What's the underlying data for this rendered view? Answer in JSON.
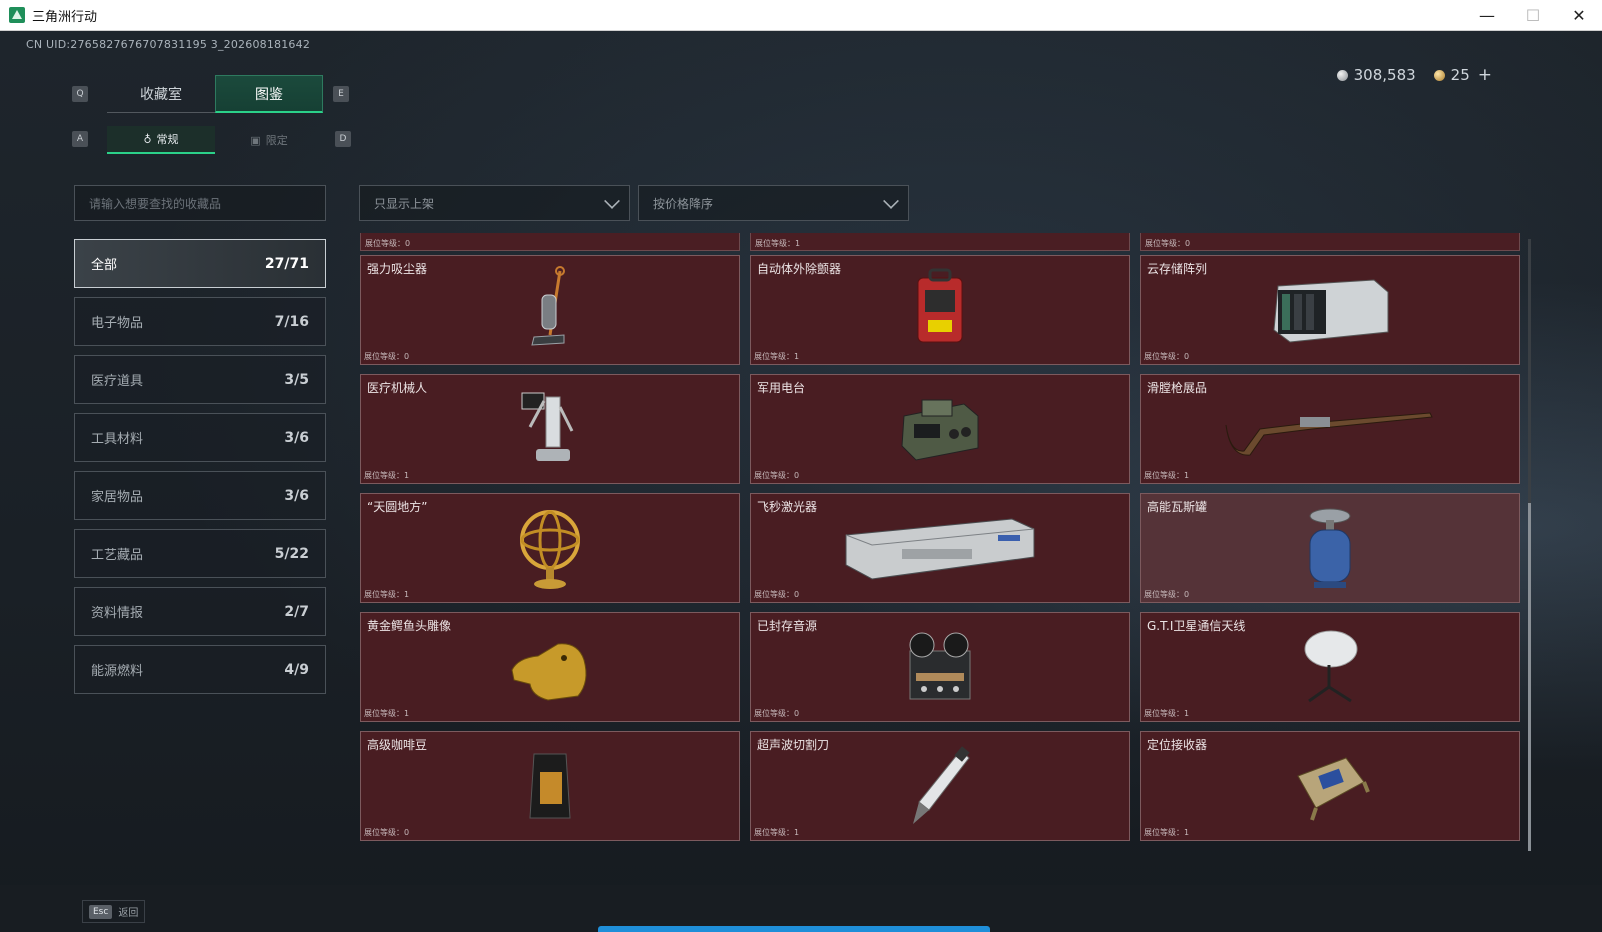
{
  "window": {
    "title": "三角洲行动",
    "minimize": "—",
    "maximize": "☐",
    "close": "✕"
  },
  "uid": "CN UID:2765827676707831195 3_202608181642",
  "currency": {
    "silver": "308,583",
    "gold": "25",
    "plus": "+"
  },
  "keys": {
    "q": "Q",
    "e": "E",
    "a": "A",
    "d": "D"
  },
  "tabs": [
    {
      "label": "收藏室"
    },
    {
      "label": "图鉴"
    }
  ],
  "subtabs": [
    {
      "label": "常规",
      "icon": "♁"
    },
    {
      "label": "限定",
      "icon": "▣"
    }
  ],
  "search": {
    "placeholder": "请输入想要查找的收藏品"
  },
  "filters": [
    {
      "label": "只显示上架"
    },
    {
      "label": "按价格降序"
    }
  ],
  "categories": [
    {
      "label": "全部",
      "count": "27/71"
    },
    {
      "label": "电子物品",
      "count": "7/16"
    },
    {
      "label": "医疗道具",
      "count": "3/5"
    },
    {
      "label": "工具材料",
      "count": "3/6"
    },
    {
      "label": "家居物品",
      "count": "3/6"
    },
    {
      "label": "工艺藏品",
      "count": "5/22"
    },
    {
      "label": "资料情报",
      "count": "2/7"
    },
    {
      "label": "能源燃料",
      "count": "4/9"
    }
  ],
  "top_strip": [
    {
      "level": "展位等级：0"
    },
    {
      "level": "展位等级：1"
    },
    {
      "level": "展位等级：0"
    }
  ],
  "items": [
    {
      "name": "强力吸尘器",
      "level": "展位等级：0",
      "icon": "vacuum-icon"
    },
    {
      "name": "自动体外除颤器",
      "level": "展位等级：1",
      "icon": "defibrillator-icon"
    },
    {
      "name": "云存储阵列",
      "level": "展位等级：0",
      "icon": "storage-array-icon"
    },
    {
      "name": "医疗机械人",
      "level": "展位等级：1",
      "icon": "medical-robot-icon"
    },
    {
      "name": "军用电台",
      "level": "展位等级：0",
      "icon": "radio-icon"
    },
    {
      "name": "滑膛枪展品",
      "level": "展位等级：1",
      "icon": "musket-icon"
    },
    {
      "name": "“天圆地方”",
      "level": "展位等级：1",
      "icon": "armillary-icon"
    },
    {
      "name": "飞秒激光器",
      "level": "展位等级：0",
      "icon": "laser-icon"
    },
    {
      "name": "高能瓦斯罐",
      "level": "展位等级：0",
      "icon": "gas-tank-icon"
    },
    {
      "name": "黄金鳄鱼头雕像",
      "level": "展位等级：1",
      "icon": "crocodile-statue-icon"
    },
    {
      "name": "已封存音源",
      "level": "展位等级：0",
      "icon": "reel-recorder-icon"
    },
    {
      "name": "G.T.I卫星通信天线",
      "level": "展位等级：1",
      "icon": "satellite-dish-icon"
    },
    {
      "name": "高级咖啡豆",
      "level": "展位等级：0",
      "icon": "coffee-bag-icon"
    },
    {
      "name": "超声波切割刀",
      "level": "展位等级：1",
      "icon": "ultrasonic-cutter-icon"
    },
    {
      "name": "定位接收器",
      "level": "展位等级：1",
      "icon": "gps-receiver-icon"
    }
  ],
  "bottom": {
    "esc_key": "Esc",
    "esc_label": "返回"
  },
  "colors": {
    "accent": "#2bd189",
    "card_bg": "#491d22",
    "card_border": "#7c5a5e",
    "progress": "#1f8fd9"
  }
}
